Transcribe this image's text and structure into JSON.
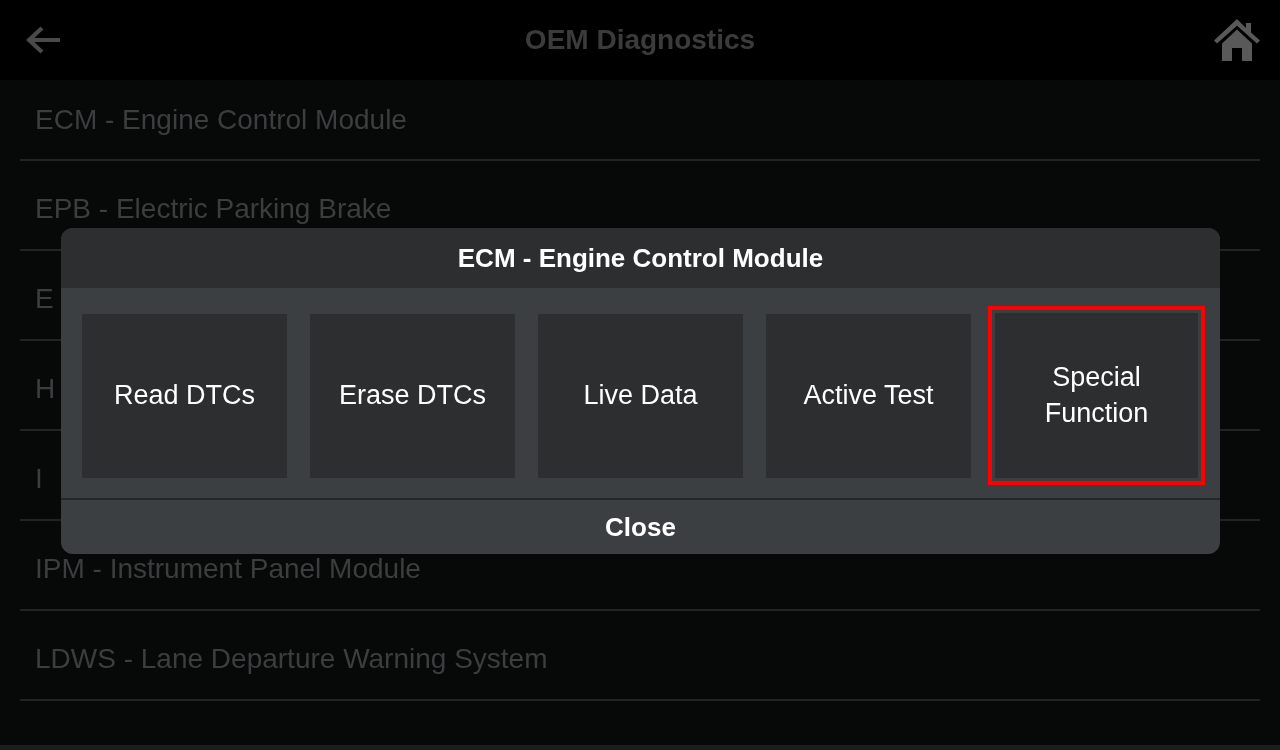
{
  "header": {
    "title": "OEM Diagnostics"
  },
  "modules": [
    "ECM - Engine Control Module",
    "EPB - Electric Parking Brake",
    "E",
    "H",
    "I",
    "IPM - Instrument Panel Module",
    "LDWS - Lane Departure Warning System"
  ],
  "dialog": {
    "title": "ECM - Engine Control Module",
    "functions": [
      {
        "label": "Read DTCs",
        "selected": false
      },
      {
        "label": "Erase DTCs",
        "selected": false
      },
      {
        "label": "Live Data",
        "selected": false
      },
      {
        "label": "Active Test",
        "selected": false
      },
      {
        "label": "Special Function",
        "selected": true
      }
    ],
    "close_label": "Close"
  }
}
